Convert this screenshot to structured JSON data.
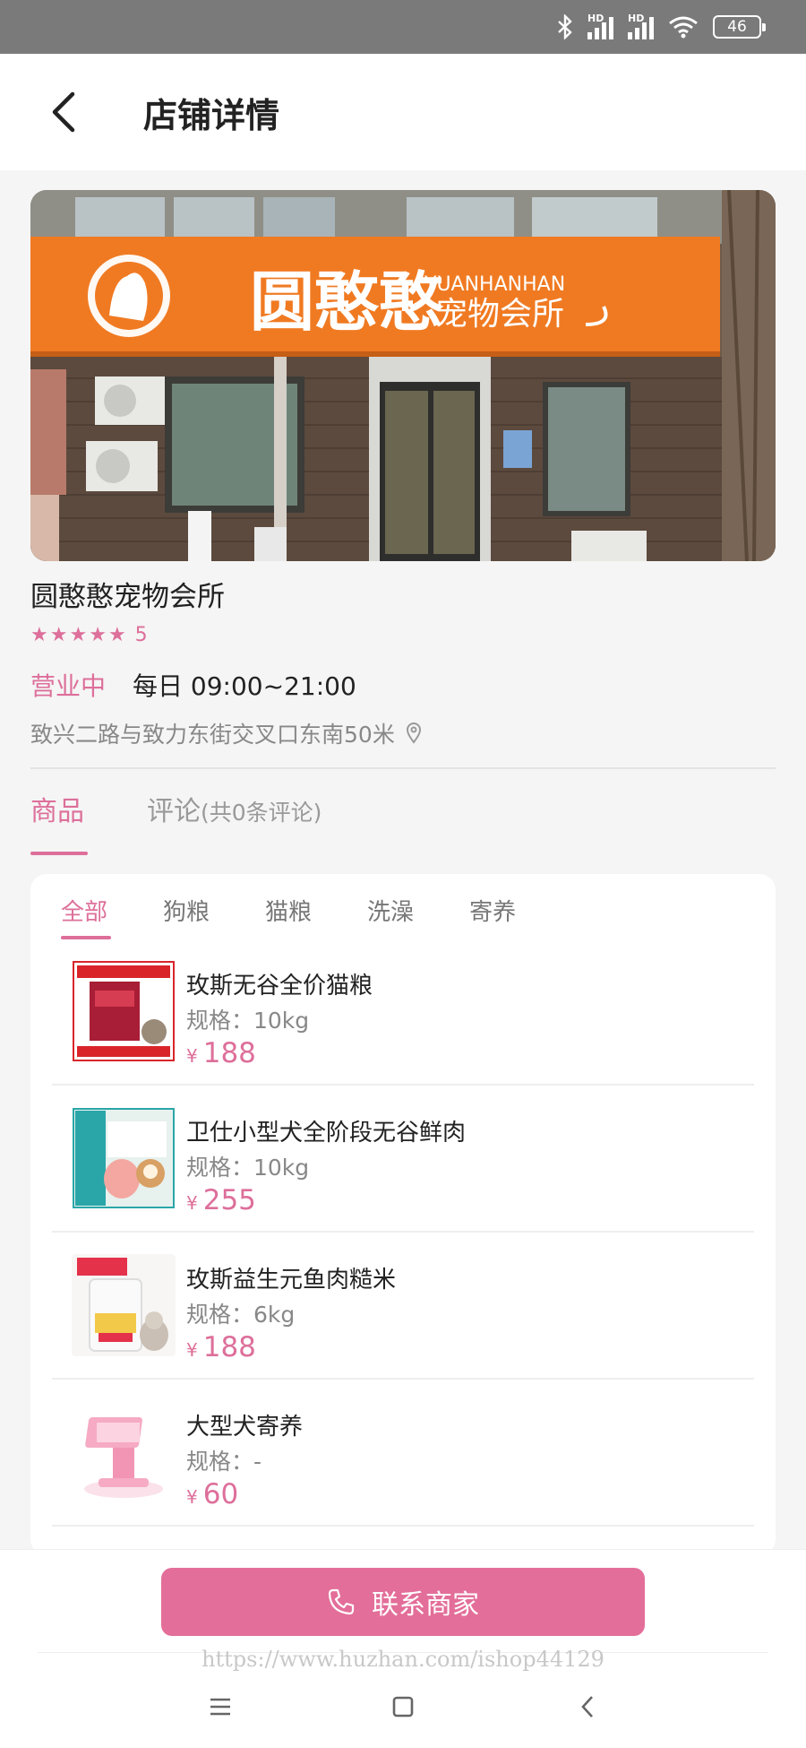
{
  "status_bar": {
    "bluetooth_icon": "bluetooth-icon",
    "signal1_label": "HD",
    "signal2_label": "HD",
    "wifi_icon": "wifi-icon",
    "battery": "46"
  },
  "header": {
    "back_icon": "chevron-left-icon",
    "title": "店铺详情"
  },
  "store": {
    "photo_sign_main": "圆憨憨",
    "photo_sign_en": "YUANHANHAN",
    "photo_sign_sub": "宠物会所",
    "name": "圆憨憨宠物会所",
    "stars": 5,
    "rating": "5",
    "status": "营业中",
    "hours": "每日 09:00~21:00",
    "address": "致兴二路与致力东街交叉口东南50米",
    "address_icon": "location-pin-icon"
  },
  "main_tabs": {
    "goods": "商品",
    "reviews": "评论",
    "reviews_count": "(共0条评论)"
  },
  "category_tabs": [
    "全部",
    "狗粮",
    "猫粮",
    "洗澡",
    "寄养"
  ],
  "products": [
    {
      "name": "玫斯无谷全价猫粮",
      "spec": "规格：10kg",
      "currency": "¥",
      "price": "188",
      "thumb": "cat-food-bag"
    },
    {
      "name": "卫仕小型犬全阶段无谷鲜肉",
      "spec": "规格：10kg",
      "currency": "¥",
      "price": "255",
      "thumb": "dog-food-bag"
    },
    {
      "name": "玫斯益生元鱼肉糙米",
      "spec": "规格：6kg",
      "currency": "¥",
      "price": "188",
      "thumb": "cat-food-bag-white"
    },
    {
      "name": "大型犬寄养",
      "spec": "规格：-",
      "currency": "¥",
      "price": "60",
      "thumb": "pink-kiosk"
    }
  ],
  "bottom": {
    "contact_label": "联系商家",
    "phone_icon": "phone-icon",
    "watermark": "https://www.huzhan.com/ishop44129"
  },
  "nav": {
    "menu_icon": "menu-icon",
    "home_icon": "home-square-icon",
    "back_icon": "back-triangle-icon"
  },
  "colors": {
    "accent": "#dd6f9a",
    "button": "#e36e99",
    "sign_orange": "#f07a22"
  }
}
